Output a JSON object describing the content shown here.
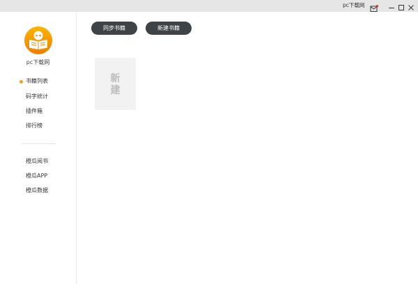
{
  "titlebar": {
    "user_label": "pc下载网",
    "icons": [
      "mail-icon",
      "minimize-icon",
      "maximize-icon",
      "close-icon"
    ],
    "notification_color": "#e0281e"
  },
  "sidebar": {
    "logo_icon": "book-reader-logo-icon",
    "brand_label": "pc下载网",
    "accent_color": "#f2a51a",
    "items": [
      {
        "label": "书籍列表",
        "active": true
      },
      {
        "label": "码字统计",
        "active": false
      },
      {
        "label": "插件箱",
        "active": false
      },
      {
        "label": "排行榜",
        "active": false
      }
    ],
    "links": [
      {
        "label": "橙瓜阅书"
      },
      {
        "label": "橙瓜APP"
      },
      {
        "label": "橙瓜数据"
      }
    ]
  },
  "toolbar": {
    "sync_label": "同步书籍",
    "new_book_label": "新建书籍"
  },
  "main": {
    "new_card_line1": "新",
    "new_card_line2": "建"
  }
}
